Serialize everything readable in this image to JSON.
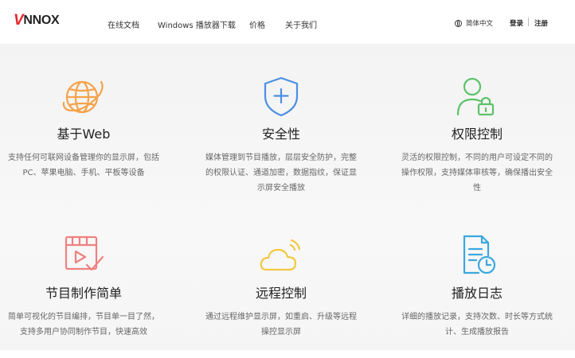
{
  "header": {
    "logo_mark": "V",
    "logo_text": "NNOX",
    "nav": [
      "在线文档",
      "Windows 播放器下载",
      "价格",
      "关于我们"
    ],
    "language": "简体中文",
    "login": "登录",
    "register": "注册"
  },
  "features": [
    {
      "title": "基于Web",
      "desc": "支持任何可联网设备管理你的显示屏，包括PC、苹果电脑、手机、平板等设备",
      "icon": "globe-icon",
      "color": "#f5a34b"
    },
    {
      "title": "安全性",
      "desc": "媒体管理到节目播放，层层安全防护，完整的权限认证、通道加密，数据指纹，保证显示屏安全播放",
      "icon": "shield-plus-icon",
      "color": "#4a90e2"
    },
    {
      "title": "权限控制",
      "desc": "灵活的权限控制，不同的用户可设定不同的操作权限，支持媒体审核等，确保播出安全性",
      "icon": "user-lock-icon",
      "color": "#5cc26b"
    },
    {
      "title": "节目制作简单",
      "desc": "简单可视化的节目编排，节目单一目了然，支持多用户协同制作节目，快速高效",
      "icon": "video-check-icon",
      "color": "#f08080"
    },
    {
      "title": "远程控制",
      "desc": "通过远程维护显示屏，如重启、升级等远程操控显示屏",
      "icon": "cloud-signal-icon",
      "color": "#f5c842"
    },
    {
      "title": "播放日志",
      "desc": "详细的播放记录，支持次数、时长等方式统计、生成播放报告",
      "icon": "log-clock-icon",
      "color": "#3aa8e0"
    }
  ]
}
